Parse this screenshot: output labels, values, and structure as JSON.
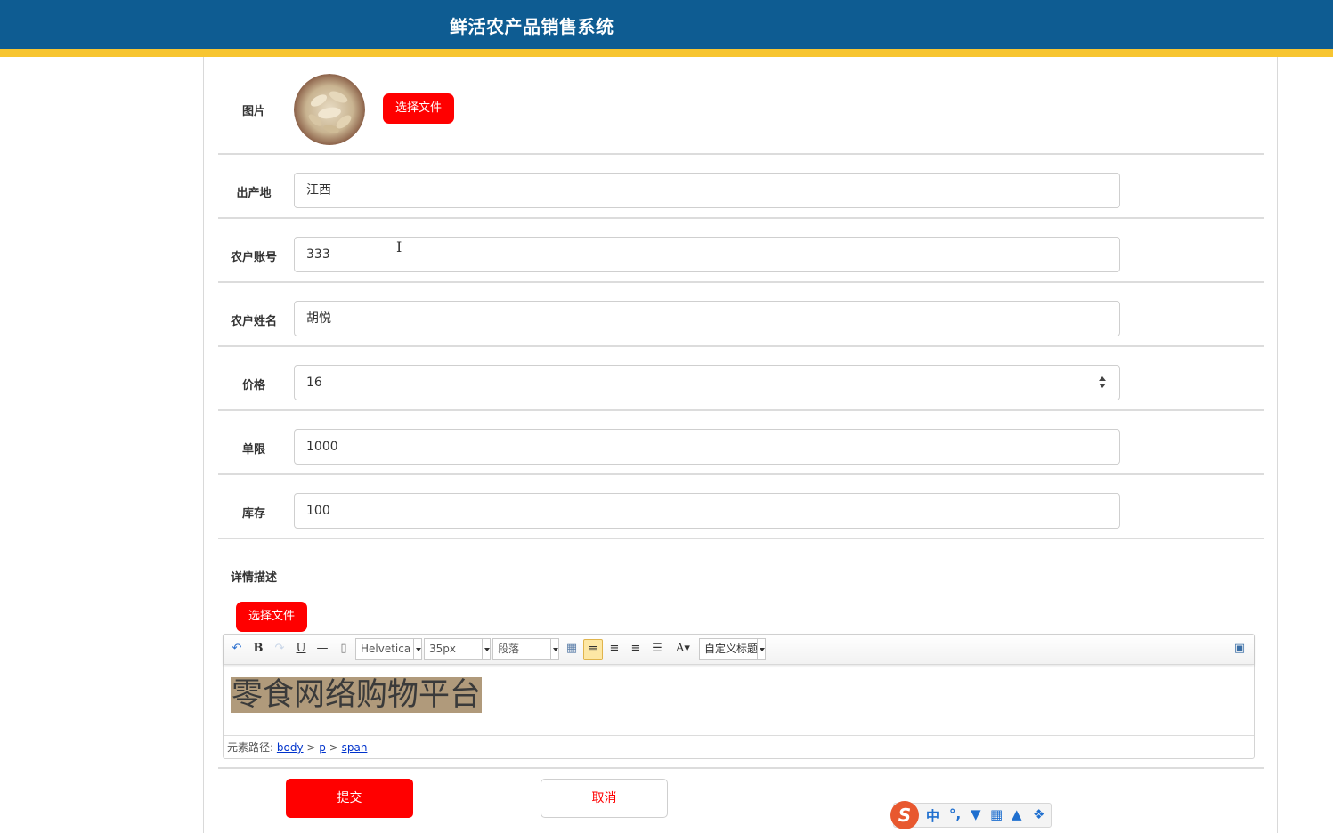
{
  "header": {
    "title": "鲜活农产品销售系统"
  },
  "form": {
    "image": {
      "label": "图片",
      "choose_button": "选择文件"
    },
    "origin": {
      "label": "出产地",
      "value": "江西"
    },
    "farmer_account": {
      "label": "农户账号",
      "value": "333"
    },
    "farmer_name": {
      "label": "农户姓名",
      "value": "胡悦"
    },
    "price": {
      "label": "价格",
      "value": "16"
    },
    "limit": {
      "label": "单限",
      "value": "1000"
    },
    "stock": {
      "label": "库存",
      "value": "100"
    },
    "description": {
      "label": "详情描述",
      "choose_button": "选择文件",
      "toolbar": {
        "font_family": "Helvetica",
        "font_size": "35px",
        "paragraph": "段落",
        "custom_heading": "自定义标题"
      },
      "content": "零食网络购物平台",
      "path_label": "元素路径:",
      "path": [
        "body",
        "p",
        "span"
      ]
    },
    "submit_label": "提交",
    "cancel_label": "取消"
  },
  "ime": {
    "mode": "中"
  },
  "colors": {
    "header": "#0e5c92",
    "stripe": "#f7c531",
    "accent": "#ff0000"
  }
}
